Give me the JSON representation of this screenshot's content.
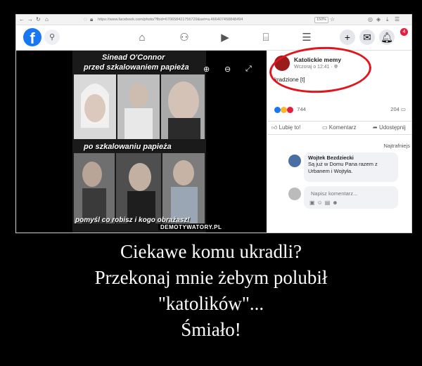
{
  "browser": {
    "url": "https://www.facebook.com/photo/?fbid=670658421756729&set=a.466407458848494",
    "zoom": "150%",
    "nav_icons": [
      "back-icon",
      "forward-icon",
      "reload-icon",
      "home-icon"
    ]
  },
  "facebook": {
    "logo": "f",
    "notification_count": "4"
  },
  "meme": {
    "title_line1": "Sinead O'Connor",
    "title_line2": "przed szkalowaniem papieża",
    "middle": "po szkalowaniu papieża",
    "bottom": "pomyśl co robisz i kogo obrażasz!",
    "watermark": "DEMOTYWATORY.PL"
  },
  "post": {
    "page_name": "Katolickie memy",
    "time": "Wczoraj o 12:41 ·",
    "text": "kradzione [t]",
    "reaction_count": "744",
    "comment_count": "204",
    "like_label": "Lubię to!",
    "comment_label": "Komentarz",
    "share_label": "Udostępnij",
    "sort_label": "Najtrafniejs",
    "commenter_name": "Wojtek Bezdziecki",
    "comment_line1": "Są już w Domu Pana razem z",
    "comment_line2": "Urbanem i Wojtyła.",
    "write_placeholder": "Napisz komentarz..."
  },
  "caption": {
    "line1": "Ciekawe komu ukradli?",
    "line2": "Przekonaj mnie żebym polubił",
    "line3": "\"katolików\"...",
    "line4": "Śmiało!"
  },
  "colors": {
    "facebook_blue": "#1877f2",
    "highlight_red": "#e2141d",
    "background": "#000000"
  }
}
